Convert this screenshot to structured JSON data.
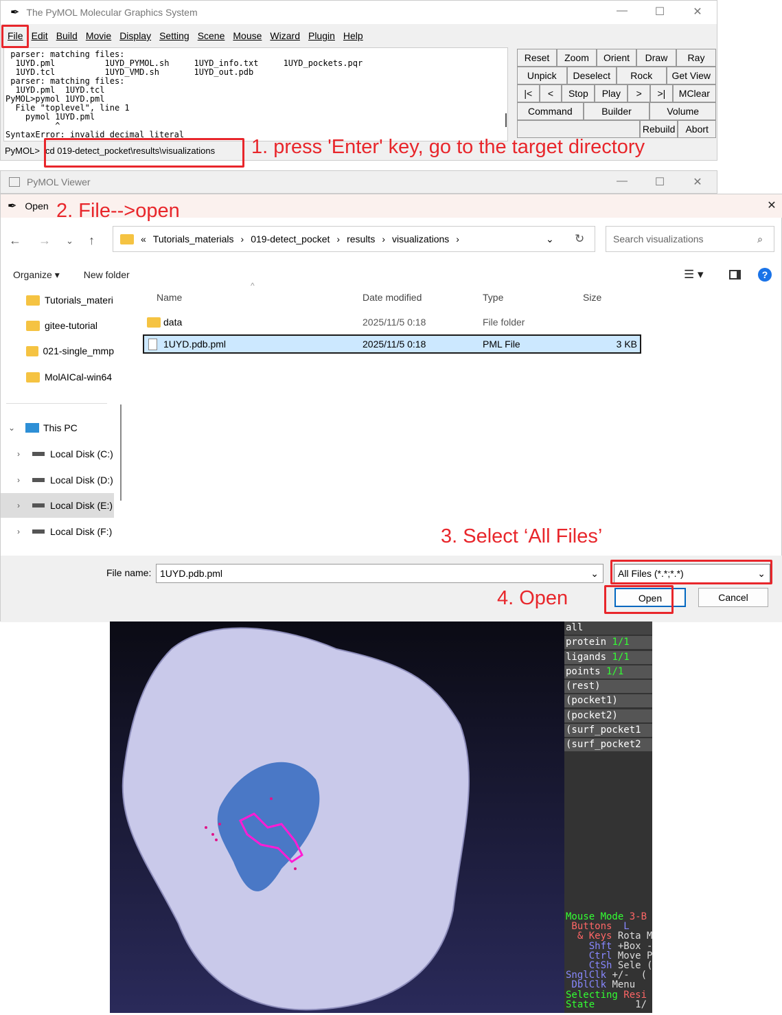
{
  "main_window": {
    "title": "The PyMOL Molecular Graphics System",
    "menu": [
      "File",
      "Edit",
      "Build",
      "Movie",
      "Display",
      "Setting",
      "Scene",
      "Mouse",
      "Wizard",
      "Plugin",
      "Help"
    ],
    "console_lines": [
      " parser: matching files:",
      "  1UYD.pml          1UYD_PYMOL.sh     1UYD_info.txt     1UYD_pockets.pqr",
      "  1UYD.tcl          1UYD_VMD.sh       1UYD_out.pdb",
      " parser: matching files:",
      "  1UYD.pml  1UYD.tcl",
      "PyMOL>pymol 1UYD.pml",
      "  File \"toplevel\", line 1",
      "    pymol 1UYD.pml",
      "          ^",
      "SyntaxError: invalid decimal literal"
    ],
    "prompt": "PyMOL>",
    "command": "cd 019-detect_pocket\\results\\visualizations",
    "buttons": [
      [
        "Reset",
        "Zoom",
        "Orient",
        "Draw",
        "Ray"
      ],
      [
        "Unpick",
        "Deselect",
        "Rock",
        "Get View"
      ],
      [
        "|<",
        "<",
        "Stop",
        "Play",
        ">",
        ">|",
        "MClear"
      ],
      [
        "Command",
        "Builder",
        "Volume"
      ],
      [
        "Rebuild",
        "Abort"
      ]
    ]
  },
  "annotations": {
    "step1": "1. press 'Enter' key, go to the target directory",
    "step2": "2. File-->open",
    "step3": "3. Select ‘All Files’",
    "step4": "4. Open"
  },
  "viewer_window": {
    "title": "PyMOL Viewer"
  },
  "dialog": {
    "title": "Open",
    "breadcrumb": [
      "«",
      "Tutorials_materials",
      "019-detect_pocket",
      "results",
      "visualizations"
    ],
    "search_placeholder": "Search visualizations",
    "organize": "Organize ▾",
    "new_folder": "New folder",
    "tree": [
      {
        "label": "Tutorials_materi",
        "type": "folder"
      },
      {
        "label": "gitee-tutorial",
        "type": "folder"
      },
      {
        "label": "021-single_mmp",
        "type": "folder"
      },
      {
        "label": "MolAICal-win64",
        "type": "folder"
      },
      {
        "label": "This PC",
        "type": "pc"
      },
      {
        "label": "Local Disk (C:)",
        "type": "disk"
      },
      {
        "label": "Local Disk (D:)",
        "type": "disk"
      },
      {
        "label": "Local Disk (E:)",
        "type": "disk"
      },
      {
        "label": "Local Disk (F:)",
        "type": "disk"
      }
    ],
    "columns": [
      "Name",
      "Date modified",
      "Type",
      "Size"
    ],
    "files": [
      {
        "name": "data",
        "date": "2025/11/5 0:18",
        "type": "File folder",
        "size": ""
      },
      {
        "name": "1UYD.pdb.pml",
        "date": "2025/11/5 0:18",
        "type": "PML File",
        "size": "3 KB"
      }
    ],
    "filename_label": "File name:",
    "filename": "1UYD.pdb.pml",
    "filetype": "All Files (*.*;*.*)",
    "open": "Open",
    "cancel": "Cancel"
  },
  "objects": [
    {
      "name": "all",
      "count": ""
    },
    {
      "name": "protein",
      "count": "1/1"
    },
    {
      "name": "ligands",
      "count": "1/1"
    },
    {
      "name": "points",
      "count": "1/1"
    },
    {
      "name": "(rest)",
      "count": ""
    },
    {
      "name": "(pocket1)",
      "count": ""
    },
    {
      "name": "(pocket2)",
      "count": ""
    },
    {
      "name": "(surf_pocket1",
      "count": ""
    },
    {
      "name": "(surf_pocket2",
      "count": ""
    }
  ],
  "mouse_mode": {
    "l1a": "Mouse Mode ",
    "l1b": "3-B",
    "l2a": " Buttons ",
    "l2b": " L",
    "l3a": "  & Keys",
    "l3b": " Rota M",
    "l4a": "    Shft",
    "l4b": " +Box -",
    "l5a": "    Ctrl",
    "l5b": " Move P",
    "l6a": "    CtSh",
    "l6b": " Sele (",
    "l7a": "SnglClk",
    "l7b": " +/-  (",
    "l8a": " DblClk",
    "l8b": " Menu",
    "l9a": "Selecting ",
    "l9b": "Resi",
    "l10a": "State",
    "l10b": "       1/"
  }
}
